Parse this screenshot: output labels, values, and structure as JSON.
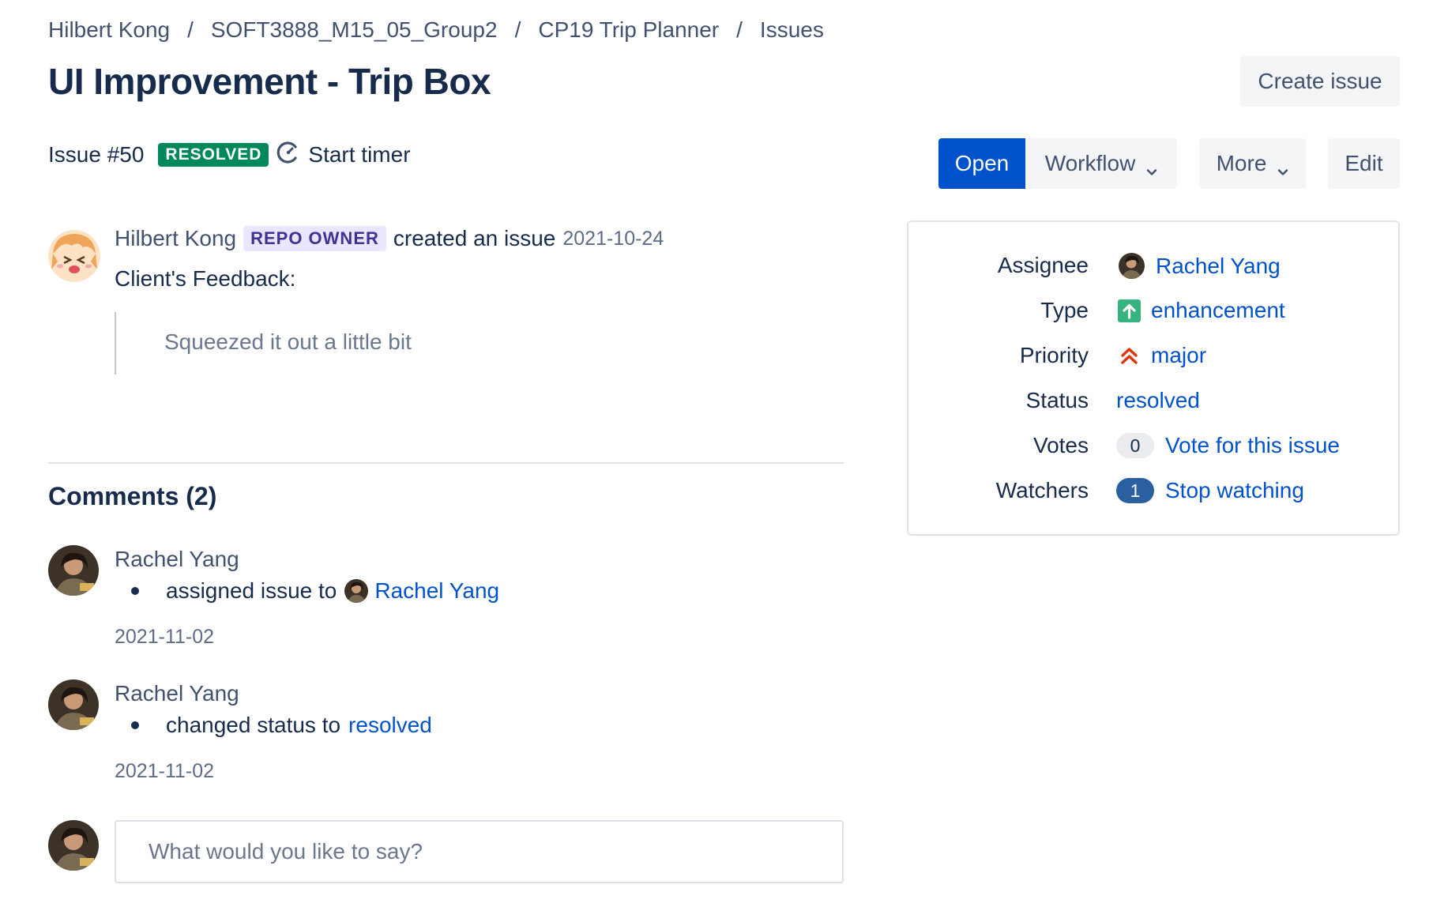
{
  "breadcrumb": [
    {
      "label": "Hilbert Kong"
    },
    {
      "label": "SOFT3888_M15_05_Group2"
    },
    {
      "label": "CP19 Trip Planner"
    },
    {
      "label": "Issues"
    }
  ],
  "breadcrumb_separator": "/",
  "title": "UI Improvement - Trip Box",
  "create_issue_label": "Create issue",
  "issue": {
    "number_label": "Issue #50",
    "status_lozenge": "RESOLVED",
    "timer_label": "Start timer"
  },
  "actions": {
    "open_label": "Open",
    "workflow_label": "Workflow",
    "more_label": "More",
    "edit_label": "Edit"
  },
  "description": {
    "author": "Hilbert Kong",
    "role_badge": "REPO OWNER",
    "action": "created an issue",
    "date": "2021-10-24",
    "line1": "Client's Feedback:",
    "quote": "Squeezed it out a little bit"
  },
  "comments": {
    "title": "Comments (2)",
    "items": [
      {
        "author": "Rachel Yang",
        "text": "assigned issue to",
        "link": "Rachel Yang",
        "date": "2021-11-02"
      },
      {
        "author": "Rachel Yang",
        "text": "changed status to",
        "link": "resolved",
        "date": "2021-11-02"
      }
    ],
    "reply_placeholder": "What would you like to say?"
  },
  "sidebar": {
    "assignee_label": "Assignee",
    "assignee_value": "Rachel Yang",
    "type_label": "Type",
    "type_value": "enhancement",
    "priority_label": "Priority",
    "priority_value": "major",
    "status_label": "Status",
    "status_value": "resolved",
    "votes_label": "Votes",
    "votes_count": "0",
    "votes_action": "Vote for this issue",
    "watchers_label": "Watchers",
    "watchers_count": "1",
    "watchers_action": "Stop watching"
  },
  "colors": {
    "primary": "#0052cc",
    "resolved_green": "#00875a",
    "owner_badge_bg": "#eae6ff",
    "owner_badge_fg": "#403294",
    "type_green": "#36b37e",
    "priority_red": "#de350b"
  },
  "icons": {
    "timer": "timer-icon",
    "chevron": "chevron-down-icon",
    "type": "enhancement-arrow-up-icon",
    "priority": "major-double-chevron-up-icon"
  }
}
